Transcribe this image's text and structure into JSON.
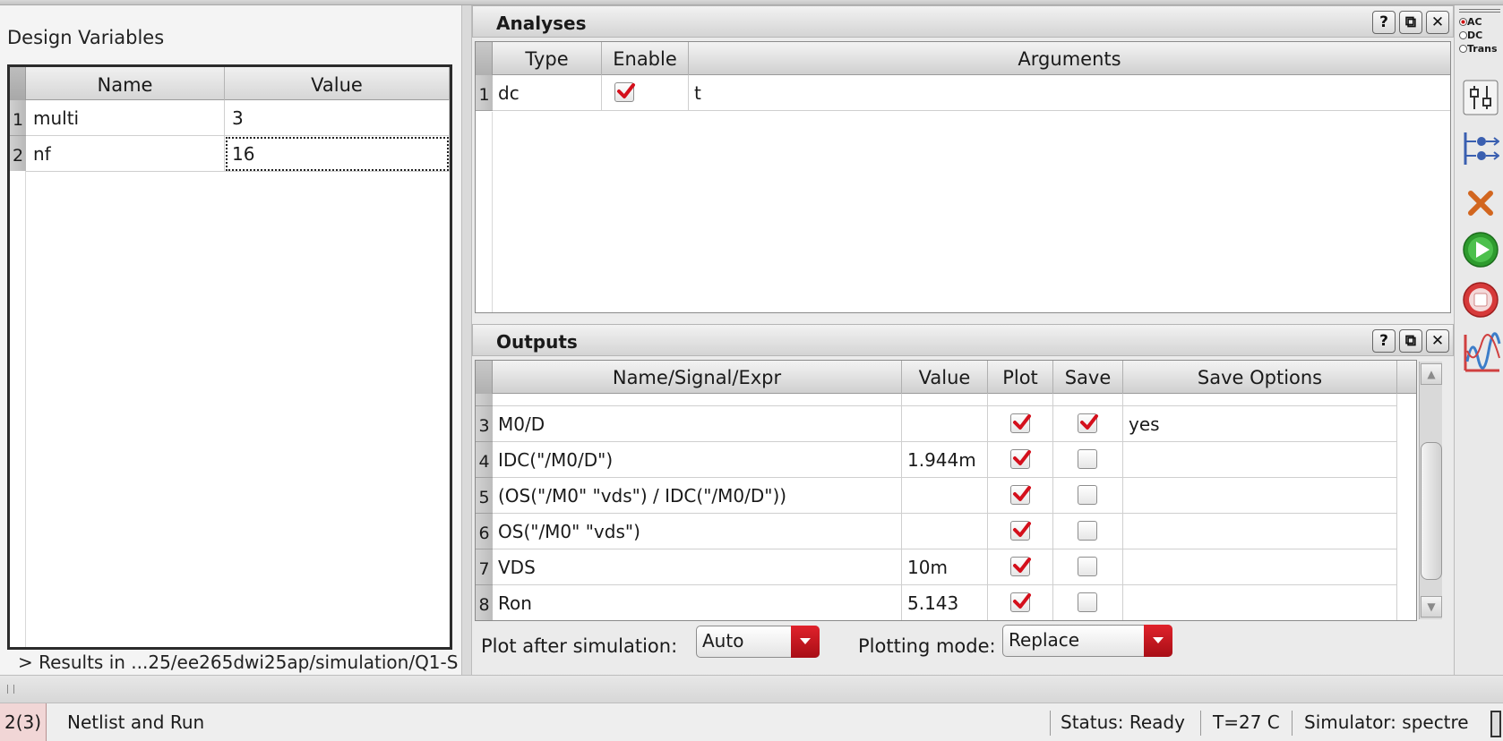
{
  "design_variables": {
    "title": "Design Variables",
    "columns": [
      "Name",
      "Value"
    ],
    "rows": [
      {
        "num": "1",
        "name": "multi",
        "value": "3"
      },
      {
        "num": "2",
        "name": "nf",
        "value": "16"
      }
    ],
    "results_text": "> Results in ...25/ee265dwi25ap/simulation/Q1-S"
  },
  "analyses": {
    "title": "Analyses",
    "columns": [
      "Type",
      "Enable",
      "Arguments"
    ],
    "rows": [
      {
        "num": "1",
        "type": "dc",
        "enabled": true,
        "arguments": "t"
      }
    ]
  },
  "outputs": {
    "title": "Outputs",
    "columns": [
      "Name/Signal/Expr",
      "Value",
      "Plot",
      "Save",
      "Save Options"
    ],
    "rows": [
      {
        "num": "3",
        "name": "M0/D",
        "value": "",
        "plot": true,
        "save": true,
        "save_options": "yes"
      },
      {
        "num": "4",
        "name": "IDC(\"/M0/D\")",
        "value": "1.944m",
        "plot": true,
        "save": false,
        "save_options": ""
      },
      {
        "num": "5",
        "name": "(OS(\"/M0\" \"vds\") / IDC(\"/M0/D\"))",
        "value": "",
        "plot": true,
        "save": false,
        "save_options": ""
      },
      {
        "num": "6",
        "name": "OS(\"/M0\" \"vds\")",
        "value": "",
        "plot": true,
        "save": false,
        "save_options": ""
      },
      {
        "num": "7",
        "name": "VDS",
        "value": "10m",
        "plot": true,
        "save": false,
        "save_options": ""
      },
      {
        "num": "8",
        "name": "Ron",
        "value": "5.143",
        "plot": true,
        "save": false,
        "save_options": ""
      }
    ],
    "plot_after_label": "Plot after simulation:",
    "plot_after_value": "Auto",
    "plotting_mode_label": "Plotting mode:",
    "plotting_mode_value": "Replace"
  },
  "dock_buttons": {
    "help": "?",
    "float": "⧉",
    "close": "✕"
  },
  "toolbar": {
    "analysis_radio": [
      "AC",
      "DC",
      "Trans"
    ]
  },
  "statusbar": {
    "counter": "2(3)",
    "action": "Netlist and Run",
    "status": "Status: Ready",
    "temperature": "T=27 C",
    "simulator": "Simulator: spectre"
  },
  "colors": {
    "check_red": "#d4101c",
    "combo_red": "#c4141d",
    "run_green": "#2e9b2e",
    "stop_red": "#d63a3a"
  }
}
